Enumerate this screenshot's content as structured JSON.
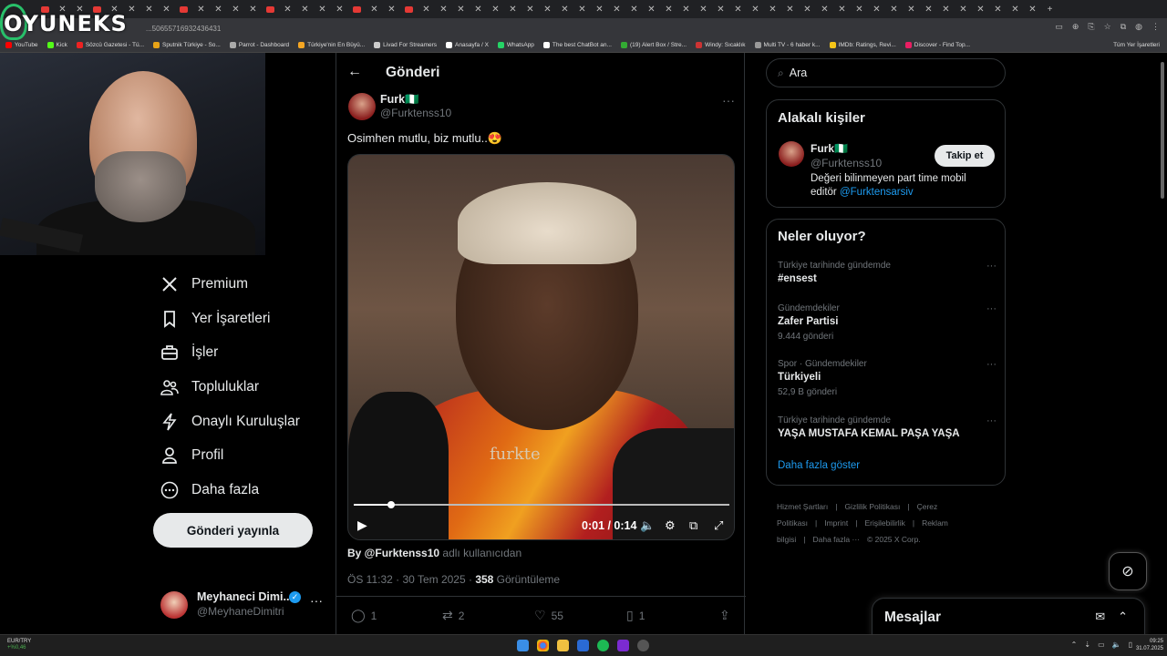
{
  "browser": {
    "url": "...50655716932436431",
    "bookmarks": [
      "YouTube",
      "Kick",
      "Sözcü Gazetesi - Tü...",
      "Sputnik Türkiye - So...",
      "Parrot - Dashboard",
      "Türkiye'nin En Büyü...",
      "Livad For Streamers",
      "Anasayfa / X",
      "WhatsApp",
      "The best ChatBot an...",
      "(19) Alert Box / Stre...",
      "Windy: Sıcaklık",
      "Multi TV - 6 haber k...",
      "IMDb: Ratings, Revi...",
      "Discover - Find Top..."
    ],
    "bookmarks_all": "Tüm Yer İşaretleri",
    "new_tab": "+"
  },
  "overlay": {
    "logo": "OYUNEKS"
  },
  "nav": {
    "items": [
      "Premium",
      "Yer İşaretleri",
      "İşler",
      "Topluluklar",
      "Onaylı Kuruluşlar",
      "Profil",
      "Daha fazla"
    ],
    "post_button": "Gönderi yayınla",
    "account": {
      "name": "Meyhaneci Dimi...",
      "handle": "@MeyhaneDimitri",
      "verified_icon": "✓",
      "more": "···"
    }
  },
  "main": {
    "title": "Gönderi",
    "tweet": {
      "name": "Furk🇳🇬",
      "handle": "@Furktenss10",
      "text": "Osimhen mutlu, biz mutlu..😍",
      "video": {
        "watermark": "furkte",
        "time": "0:01 / 0:14",
        "progress": 0.1
      },
      "attribution_user": "By @Furktenss10",
      "attribution_suffix": " adlı kullanıcıdan",
      "meta_prefix": "ÖS 11:32 · 30 Tem 2025 · ",
      "views": "358",
      "views_label": " Görüntüleme",
      "actions": {
        "replies": "1",
        "reposts": "2",
        "likes": "55",
        "bookmarks": "1"
      }
    }
  },
  "right": {
    "search_placeholder": "Ara",
    "relevant": {
      "title": "Alakalı kişiler",
      "name": "Furk🇳🇬",
      "handle": "@Furktenss10",
      "follow": "Takip et",
      "bio": "Değeri bilinmeyen part time mobil editör ",
      "bio_link": "@Furktensarsiv"
    },
    "trends": {
      "title": "Neler oluyor?",
      "items": [
        {
          "cat": "Türkiye tarihinde gündemde",
          "name": "#ensest",
          "count": ""
        },
        {
          "cat": "Gündemdekiler",
          "name": "Zafer Partisi",
          "count": "9.444 gönderi"
        },
        {
          "cat": "Spor · Gündemdekiler",
          "name": "Türkiyeli",
          "count": "52,9 B gönderi"
        },
        {
          "cat": "Türkiye tarihinde gündemde",
          "name": "YAŞA MUSTAFA KEMAL PAŞA YAŞA",
          "count": ""
        }
      ],
      "show_more": "Daha fazla göster"
    },
    "footer": [
      "Hizmet Şartları",
      "|",
      "Gizlilik Politikası",
      "|",
      "Çerez Politikası",
      "|",
      "Imprint",
      "|",
      "Erişilebilirlik",
      "|",
      "Reklam bilgisi",
      "|",
      "Daha fazla ···",
      "© 2025 X Corp."
    ]
  },
  "messages": {
    "title": "Mesajlar"
  },
  "taskbar": {
    "ticker_name": "EUR/TRY",
    "ticker_change": "+%0,46",
    "time": "09:25",
    "date": "31.07.2025"
  },
  "colors": {
    "accent": "#1d9bf0",
    "bg": "#000000",
    "border": "#2f3336",
    "muted": "#71767b",
    "text": "#e7e9ea"
  }
}
